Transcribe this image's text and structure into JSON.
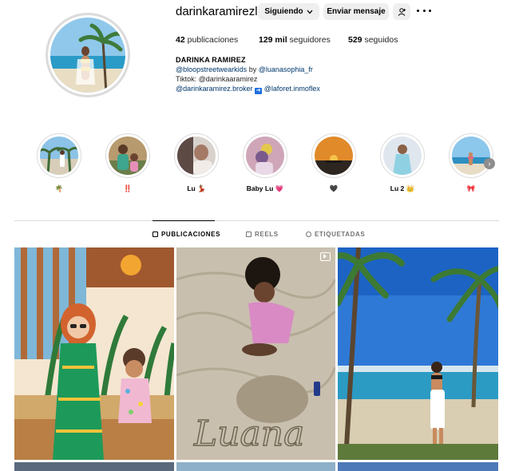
{
  "profile": {
    "username": "darinkaramirezl",
    "following_button": "Siguiendo",
    "message_button": "Enviar mensaje",
    "stats": {
      "posts_count": "42",
      "posts_label": "publicaciones",
      "followers_count": "129 mil",
      "followers_label": "seguidores",
      "following_count": "529",
      "following_label": "seguidos"
    },
    "full_name": "DARINKA RAMIREZ",
    "bio": {
      "line1_link1": "@bloopstreetwearkids",
      "line1_by": " by ",
      "line1_link2": "@luanasophia_fr",
      "line2": "Tiktok: @darinkaaramirez",
      "line3_link1": "@darinkaramirez.broker",
      "line3_link2": "@laforet.inmoflex"
    }
  },
  "highlights": [
    {
      "label": "🌴"
    },
    {
      "label": "‼️"
    },
    {
      "label": "Lu 💃🏽"
    },
    {
      "label": "Baby Lu 💗"
    },
    {
      "label": "🖤"
    },
    {
      "label": "Lu 2 👑"
    },
    {
      "label": "🎀"
    }
  ],
  "tabs": {
    "posts": "PUBLICACIONES",
    "reels": "REELS",
    "tagged": "ETIQUETADAS"
  },
  "post_sand_text": "Luana",
  "icons": {
    "following": "chevron-down-icon",
    "suggest": "add-person-icon",
    "more": "more-options-icon",
    "reel": "reel-icon",
    "highlight_next": "chevron-right-icon"
  },
  "colors": {
    "button_bg": "#efefef",
    "link": "#00376b",
    "divider": "#dbdbdb",
    "muted_text": "#737373"
  }
}
